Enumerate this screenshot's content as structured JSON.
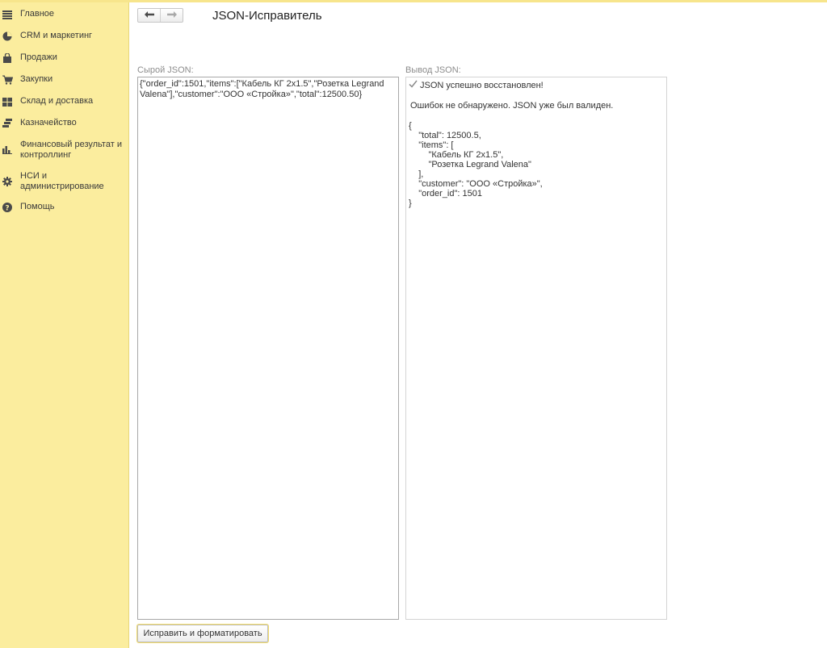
{
  "sidebar": {
    "items": [
      {
        "label": "Главное",
        "icon": "menu-lines-icon"
      },
      {
        "label": "CRM и маркетинг",
        "icon": "pie-chart-icon"
      },
      {
        "label": "Продажи",
        "icon": "shopping-bag-icon"
      },
      {
        "label": "Закупки",
        "icon": "shopping-cart-icon"
      },
      {
        "label": "Склад и доставка",
        "icon": "warehouse-grid-icon"
      },
      {
        "label": "Казначейство",
        "icon": "coins-stack-icon"
      },
      {
        "label": "Финансовый результат и контроллинг",
        "icon": "bar-chart-icon"
      },
      {
        "label": "НСИ и администрирование",
        "icon": "gear-icon"
      },
      {
        "label": "Помощь",
        "icon": "help-circle-icon"
      }
    ]
  },
  "header": {
    "title": "JSON-Исправитель",
    "back_icon": "arrow-left-icon",
    "forward_icon": "arrow-right-icon"
  },
  "input": {
    "label": "Сырой JSON:",
    "value": "{\"order_id\":1501,\"items\":[\"Кабель КГ 2x1.5\",\"Розетка Legrand Valena\"],\"customer\":\"ООО «Стройка»\",\"total\":12500.50}"
  },
  "output": {
    "label": "Вывод JSON:",
    "status": "JSON успешно восстановлен!",
    "status_icon": "check-icon",
    "message": "Ошибок не обнаружено. JSON уже был валиден.",
    "json": "{\n    \"total\": 12500.5,\n    \"items\": [\n        \"Кабель КГ 2x1.5\",\n        \"Розетка Legrand Valena\"\n    ],\n    \"customer\": \"ООО «Стройка»\",\n    \"order_id\": 1501\n}"
  },
  "actions": {
    "fix_label": "Исправить и форматировать"
  },
  "colors": {
    "sidebar_bg": "#fbed9e",
    "accent_yellow": "#f2dc6a"
  }
}
